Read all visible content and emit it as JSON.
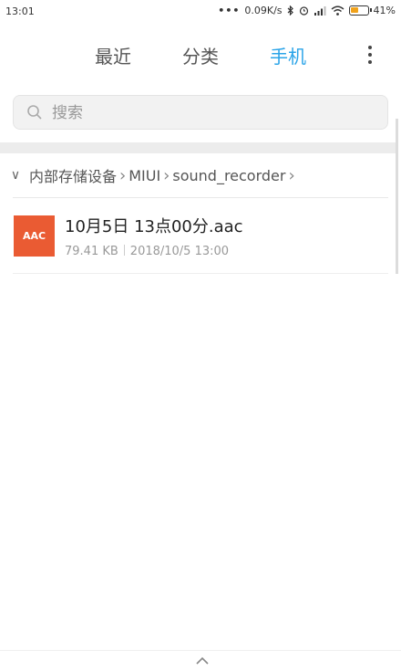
{
  "status_bar": {
    "time": "13:01",
    "dots": "•••",
    "network_speed": "0.09K/s",
    "icons": [
      "bluetooth-icon",
      "alarm-icon",
      "signal-icon",
      "wifi-icon",
      "battery-icon"
    ],
    "battery_percent": "41%"
  },
  "tabs": [
    {
      "label": "最近",
      "active": false
    },
    {
      "label": "分类",
      "active": false
    },
    {
      "label": "手机",
      "active": true
    }
  ],
  "colors": {
    "accent": "#2ba4e8",
    "file_icon_bg": "#ea5b33"
  },
  "search": {
    "placeholder": "搜索",
    "value": ""
  },
  "breadcrumb": {
    "segments": [
      "内部存储设备",
      "MIUI",
      "sound_recorder"
    ]
  },
  "files": [
    {
      "icon_label": "AAC",
      "name": "10月5日 13点00分.aac",
      "size": "79.41 KB",
      "date": "2018/10/5 13:00"
    }
  ]
}
